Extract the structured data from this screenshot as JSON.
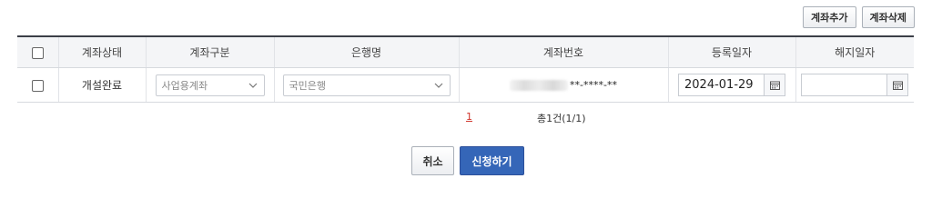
{
  "toolbar": {
    "add_account_label": "계좌추가",
    "delete_account_label": "계좌삭제"
  },
  "table": {
    "headers": [
      "계좌상태",
      "계좌구분",
      "은행명",
      "계좌번호",
      "등록일자",
      "해지일자"
    ],
    "rows": [
      {
        "checked": false,
        "status": "개설완료",
        "account_type": "사업용계좌",
        "bank_name": "국민은행",
        "account_number": "**-****-**",
        "registered_date": "2024-01-29",
        "terminated_date": ""
      }
    ]
  },
  "pagination": {
    "current_page": "1",
    "summary": "총1건(1/1)"
  },
  "actions": {
    "cancel_label": "취소",
    "submit_label": "신청하기"
  },
  "colors": {
    "submit_bg": "#3566b8",
    "page_link": "#d0352c",
    "header_border": "#3b3f47"
  }
}
